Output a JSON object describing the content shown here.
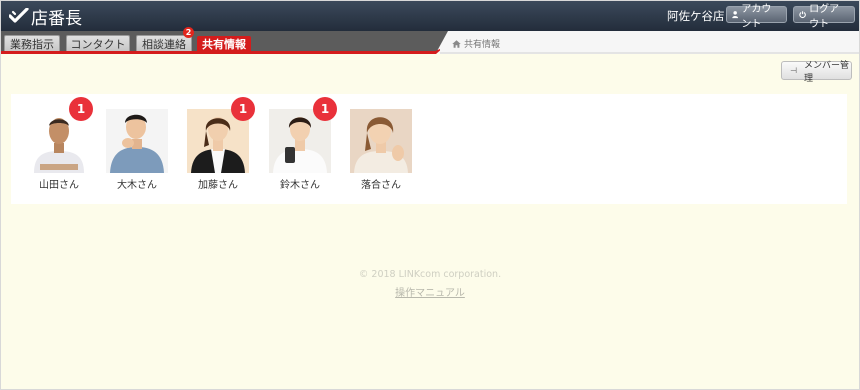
{
  "header": {
    "logo_text": "店番長",
    "store_name": "阿佐ケ谷店",
    "account_label": "アカウント",
    "logout_label": "ログアウト"
  },
  "tabs": [
    {
      "label": "業務指示",
      "active": false
    },
    {
      "label": "コンタクト",
      "active": false
    },
    {
      "label": "相談連絡",
      "active": false,
      "badge": "2"
    },
    {
      "label": "共有情報",
      "active": true
    }
  ],
  "breadcrumb": "共有情報",
  "member_button": "メンバー管理",
  "members": [
    {
      "name": "山田さん",
      "badge": "1"
    },
    {
      "name": "大木さん",
      "badge": ""
    },
    {
      "name": "加藤さん",
      "badge": "1"
    },
    {
      "name": "鈴木さん",
      "badge": "1"
    },
    {
      "name": "落合さん",
      "badge": ""
    }
  ],
  "footer": {
    "copyright": "© 2018 LINKcom corporation.",
    "manual": "操作マニュアル"
  },
  "colors": {
    "accent": "#d41c1c",
    "header_bg": "#2d3848",
    "page_bg": "#fdfcea",
    "badge": "#e9313a"
  }
}
